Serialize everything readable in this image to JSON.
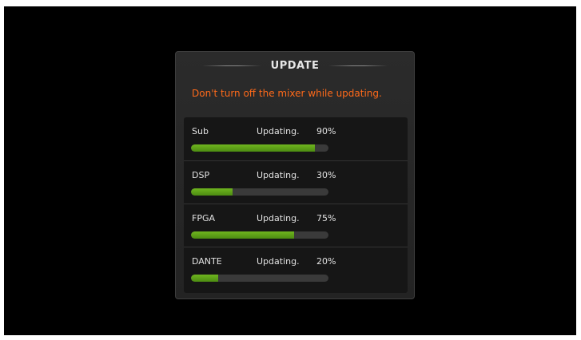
{
  "dialog": {
    "title": "UPDATE",
    "warning": "Don't turn off the mixer while updating."
  },
  "colors": {
    "warning": "#ff6a1a",
    "progress_fill": "#5fa11a",
    "progress_track": "#3a3a3a",
    "dialog_background": "#262626",
    "list_background": "#161616"
  },
  "modules": [
    {
      "name": "Sub",
      "status": "Updating.",
      "percent_label": "90%",
      "progress": 0.9
    },
    {
      "name": "DSP",
      "status": "Updating.",
      "percent_label": "30%",
      "progress": 0.3
    },
    {
      "name": "FPGA",
      "status": "Updating.",
      "percent_label": "75%",
      "progress": 0.75
    },
    {
      "name": "DANTE",
      "status": "Updating.",
      "percent_label": "20%",
      "progress": 0.2
    }
  ]
}
